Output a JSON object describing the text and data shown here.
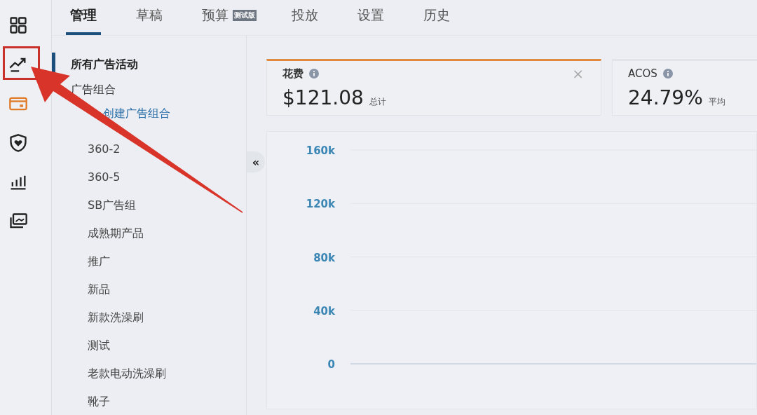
{
  "tabs": [
    {
      "label": "管理",
      "selected": true
    },
    {
      "label": "草稿",
      "selected": false
    },
    {
      "label": "预算",
      "selected": false,
      "badge": "测试版"
    },
    {
      "label": "投放",
      "selected": false
    },
    {
      "label": "设置",
      "selected": false
    },
    {
      "label": "历史",
      "selected": false
    }
  ],
  "sidebar": {
    "all_campaigns": {
      "label": "所有广告活动",
      "selected": true
    },
    "portfolios_heading": "广告组合",
    "create_link": "创建广告组合",
    "portfolios": [
      {
        "label": "360-2",
        "selected": false
      },
      {
        "label": "360-5",
        "selected": false
      },
      {
        "label": "SB广告组",
        "selected": false
      },
      {
        "label": "成熟期产品",
        "selected": false
      },
      {
        "label": "推广",
        "selected": false
      },
      {
        "label": "新品",
        "selected": false
      },
      {
        "label": "新款洗澡刷",
        "selected": false
      },
      {
        "label": "测试",
        "selected": false
      },
      {
        "label": "老款电动洗澡刷",
        "selected": false
      },
      {
        "label": "靴子",
        "selected": false
      }
    ]
  },
  "collapse_button": "«",
  "metrics": [
    {
      "label": "花费",
      "value": "$121.08",
      "suffix": "总计",
      "selected": true,
      "close": "×"
    },
    {
      "label": "ACOS",
      "value": "24.79%",
      "suffix": "平均",
      "selected": false
    }
  ],
  "chart": {
    "y_axis_labels": [
      "160k",
      "120k",
      "80k",
      "40k",
      "0"
    ]
  }
}
